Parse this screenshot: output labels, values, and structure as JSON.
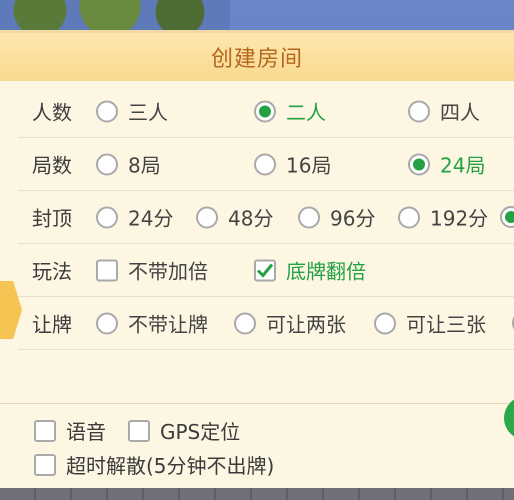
{
  "title": "创建房间",
  "rows": [
    {
      "label": "人数",
      "options": [
        {
          "label": "三人",
          "selected": false
        },
        {
          "label": "二人",
          "selected": true
        },
        {
          "label": "四人",
          "selected": false
        }
      ]
    },
    {
      "label": "局数",
      "options": [
        {
          "label": "8局",
          "selected": false
        },
        {
          "label": "16局",
          "selected": false
        },
        {
          "label": "24局",
          "selected": true
        }
      ]
    },
    {
      "label": "封顶",
      "options": [
        {
          "label": "24分",
          "selected": false
        },
        {
          "label": "48分",
          "selected": false
        },
        {
          "label": "96分",
          "selected": false
        },
        {
          "label": "192分",
          "selected": false
        },
        {
          "label": "",
          "selected": true
        }
      ]
    },
    {
      "label": "玩法",
      "options": [
        {
          "label": "不带加倍",
          "checked": false
        },
        {
          "label": "底牌翻倍",
          "checked": true
        }
      ]
    },
    {
      "label": "让牌",
      "options": [
        {
          "label": "不带让牌",
          "selected": false
        },
        {
          "label": "可让两张",
          "selected": false
        },
        {
          "label": "可让三张",
          "selected": false
        },
        {
          "label": "",
          "selected": false
        }
      ]
    }
  ],
  "footer": {
    "voice": {
      "label": "语音",
      "checked": false
    },
    "gps": {
      "label": "GPS定位",
      "checked": false
    },
    "timeout": {
      "label": "超时解散(5分钟不出牌)",
      "checked": false
    }
  },
  "colors": {
    "accent_green": "#23a143",
    "title_color": "#b5651d",
    "panel_bg": "#fdf6e3"
  }
}
